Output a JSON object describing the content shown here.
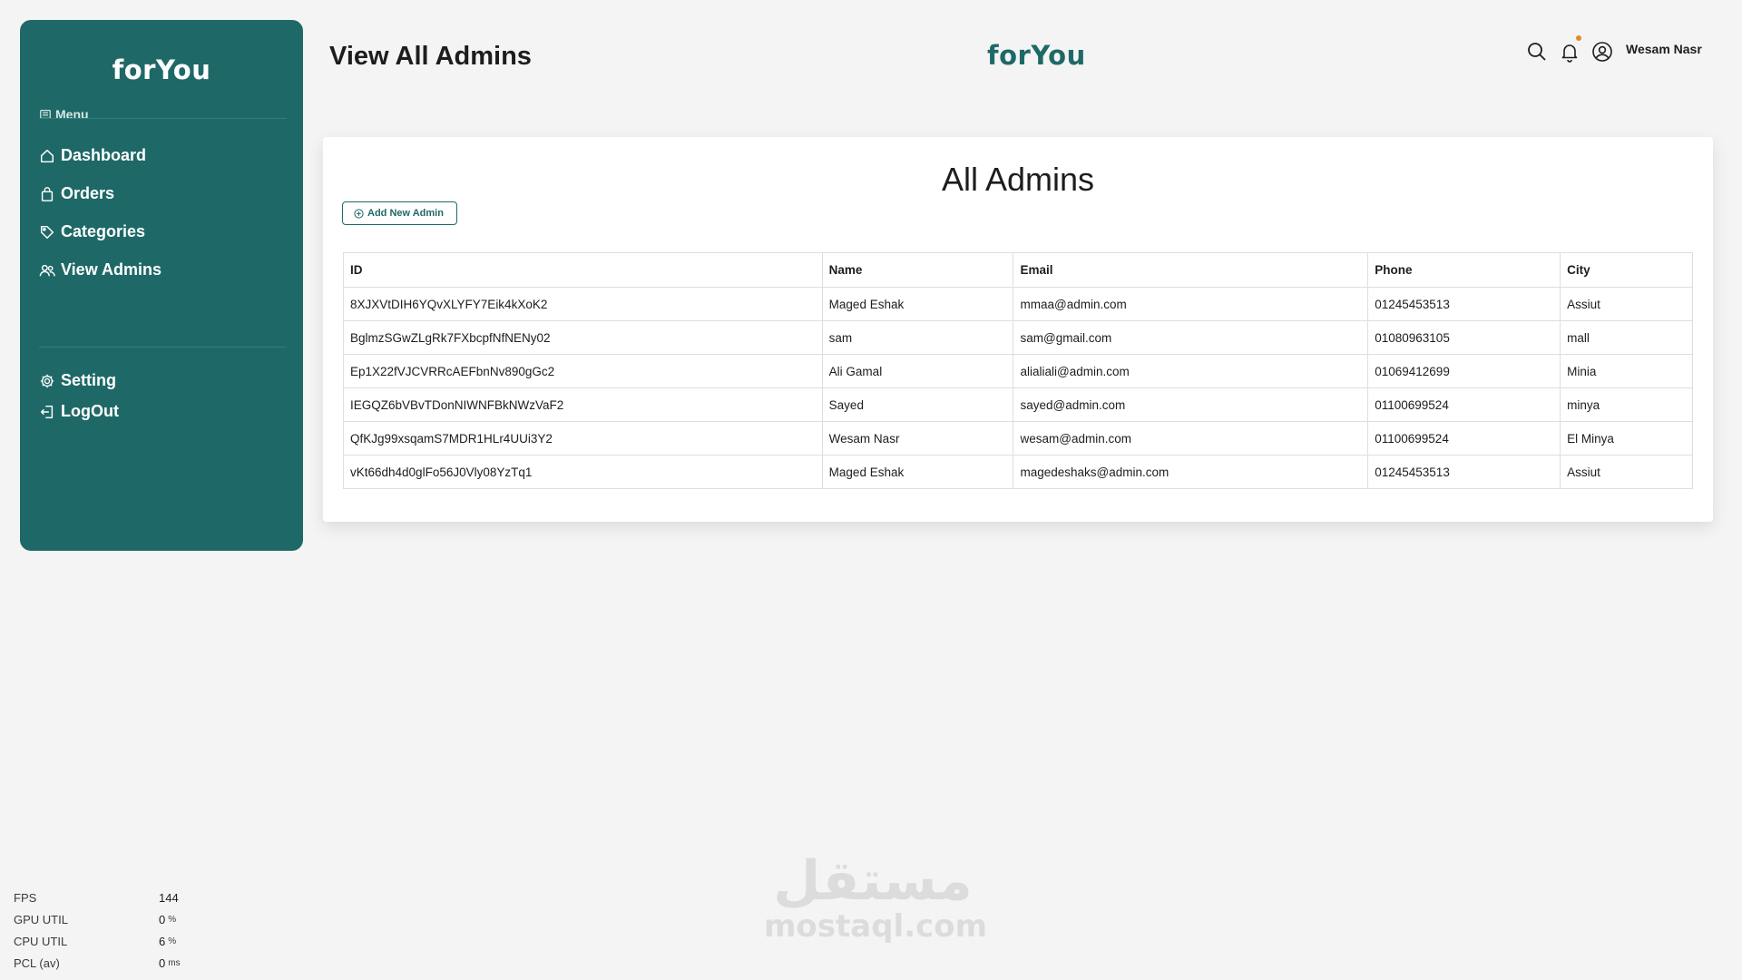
{
  "brand": {
    "name": "forYou",
    "primary_color": "#1e6967"
  },
  "sidebar": {
    "menu_label": "Menu",
    "items": [
      {
        "label": "Dashboard",
        "icon": "home-icon"
      },
      {
        "label": "Orders",
        "icon": "shopping-bag-icon"
      },
      {
        "label": "Categories",
        "icon": "tag-icon"
      },
      {
        "label": "View Admins",
        "icon": "users-icon"
      }
    ],
    "bottom_items": [
      {
        "label": "Setting",
        "icon": "gear-icon"
      },
      {
        "label": "LogOut",
        "icon": "logout-icon"
      }
    ]
  },
  "header": {
    "title": "View All Admins",
    "user_name": "Wesam Nasr",
    "icons": [
      "search-icon",
      "bell-icon",
      "user-icon"
    ]
  },
  "main": {
    "card_title": "All Admins",
    "add_button_label": "Add New Admin",
    "table": {
      "columns": [
        "ID",
        "Name",
        "Email",
        "Phone",
        "City"
      ],
      "rows": [
        [
          "8XJXVtDIH6YQvXLYFY7Eik4kXoK2",
          "Maged Eshak",
          "mmaa@admin.com",
          "01245453513",
          "Assiut"
        ],
        [
          "BglmzSGwZLgRk7FXbcpfNfNENy02",
          "sam",
          "sam@gmail.com",
          "01080963105",
          "mall"
        ],
        [
          "Ep1X22fVJCVRRcAEFbnNv890gGc2",
          "Ali Gamal",
          "alialiali@admin.com",
          "01069412699",
          "Minia"
        ],
        [
          "IEGQZ6bVBvTDonNIWNFBkNWzVaF2",
          "Sayed",
          "sayed@admin.com",
          "01100699524",
          "minya"
        ],
        [
          "QfKJg99xsqamS7MDR1HLr4UUi3Y2",
          "Wesam Nasr",
          "wesam@admin.com",
          "01100699524",
          "El Minya"
        ],
        [
          "vKt66dh4d0glFo56J0Vly08YzTq1",
          "Maged Eshak",
          "magedeshaks@admin.com",
          "01245453513",
          "Assiut"
        ]
      ]
    }
  },
  "perf_overlay": [
    {
      "label": "FPS",
      "value": "144",
      "unit": ""
    },
    {
      "label": "GPU UTIL",
      "value": "0",
      "unit": "%"
    },
    {
      "label": "CPU UTIL",
      "value": "6",
      "unit": "%"
    },
    {
      "label": "PCL (av)",
      "value": "0",
      "unit": "ms"
    }
  ],
  "watermark": {
    "arabic": "مستقل",
    "latin": "mostaql.com"
  }
}
